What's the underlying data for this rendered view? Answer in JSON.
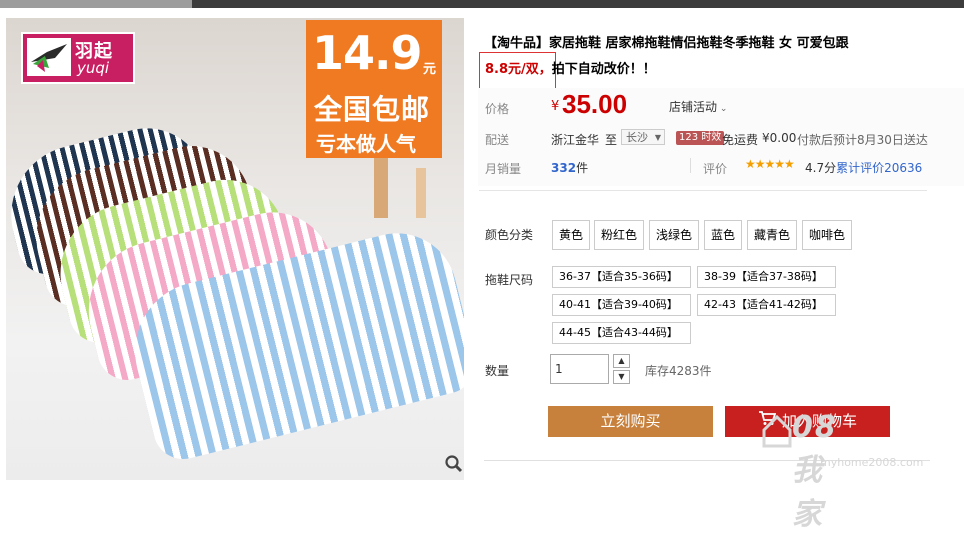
{
  "product": {
    "title": "【淘牛品】家居拖鞋 居家棉拖鞋情侣拖鞋冬季拖鞋 女 可爱包跟",
    "promo_price_note": "8.8元/双，",
    "promo_auto_note": "拍下自动改价！！"
  },
  "image": {
    "brand_cn": "羽起",
    "brand_en": "yuqi",
    "promo_price": "14.9",
    "promo_unit": "元",
    "promo_line2": "全国包邮",
    "promo_line3": "亏本做人气",
    "zoom_icon": "magnifier-icon"
  },
  "price": {
    "label": "价格",
    "symbol": "¥",
    "value": "35.00",
    "activity": "店铺活动"
  },
  "shipping": {
    "label": "配送",
    "from": "浙江金华",
    "to_word": "至",
    "city": "长沙",
    "badge": "123 时效",
    "free": "免运费",
    "fee": "¥0.00",
    "eta": "付款后预计8月30日送达"
  },
  "sales": {
    "label": "月销量",
    "count": "332",
    "unit": "件",
    "rating_label": "评价",
    "stars": "★★★★★",
    "rating": "4.7分",
    "review_text": "累计评价20636"
  },
  "options": {
    "color_label": "颜色分类",
    "colors": [
      "黄色",
      "粉红色",
      "浅绿色",
      "蓝色",
      "藏青色",
      "咖啡色"
    ],
    "size_label": "拖鞋尺码",
    "sizes": [
      "36-37【适合35-36码】",
      "38-39【适合37-38码】",
      "40-41【适合39-40码】",
      "42-43【适合41-42码】",
      "44-45【适合43-44码】"
    ]
  },
  "quantity": {
    "label": "数量",
    "value": "1",
    "stock": "库存4283件"
  },
  "actions": {
    "buy_now": "立刻购买",
    "add_cart": "加入购物车"
  },
  "watermark": {
    "line1": "08我家",
    "line2": "myhome2008.com"
  },
  "colors": {
    "accent_red": "#c00000",
    "buy_button": "#c8813d",
    "cart_button": "#c8201f",
    "promo_orange": "#f07a21",
    "brand_pink": "#c81f62"
  }
}
